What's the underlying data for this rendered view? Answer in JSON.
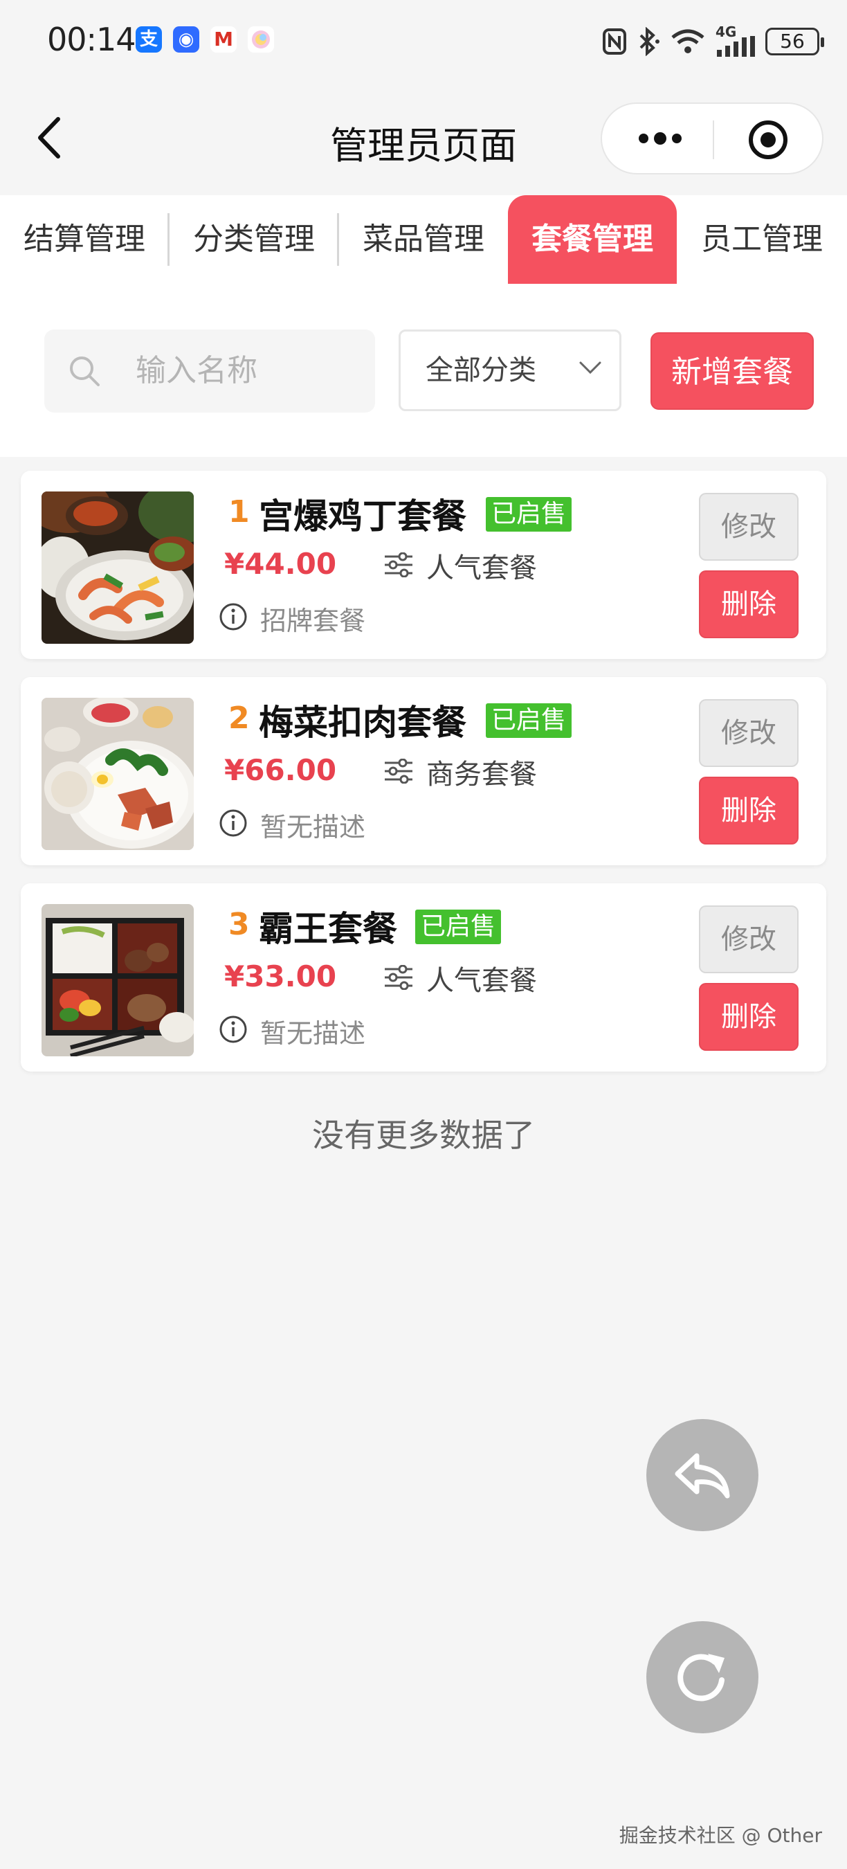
{
  "status_bar": {
    "time": "00:14",
    "network": "4G",
    "battery": "56",
    "app_icons": [
      {
        "name": "alipay-icon",
        "glyph": "支",
        "color": "#1677ff"
      },
      {
        "name": "app-shield-icon",
        "glyph": "◉",
        "color": "#2f6bff"
      },
      {
        "name": "gmail-icon",
        "glyph": "M",
        "color": "#ffffff"
      },
      {
        "name": "photos-icon",
        "glyph": "✿",
        "color": "#ffffff"
      }
    ]
  },
  "nav": {
    "title": "管理员页面"
  },
  "tabs": [
    {
      "label": "结算管理",
      "active": false
    },
    {
      "label": "分类管理",
      "active": false
    },
    {
      "label": "菜品管理",
      "active": false
    },
    {
      "label": "套餐管理",
      "active": true
    },
    {
      "label": "员工管理",
      "active": false
    }
  ],
  "filter": {
    "search_placeholder": "输入名称",
    "category_value": "全部分类",
    "add_button": "新增套餐"
  },
  "combos": [
    {
      "index": "1",
      "name": "宫爆鸡丁套餐",
      "status": "已启售",
      "price": "¥44.00",
      "category": "人气套餐",
      "description": "招牌套餐",
      "edit_label": "修改",
      "delete_label": "删除"
    },
    {
      "index": "2",
      "name": "梅菜扣肉套餐",
      "status": "已启售",
      "price": "¥66.00",
      "category": "商务套餐",
      "description": "暂无描述",
      "edit_label": "修改",
      "delete_label": "删除"
    },
    {
      "index": "3",
      "name": "霸王套餐",
      "status": "已启售",
      "price": "¥33.00",
      "category": "人气套餐",
      "description": "暂无描述",
      "edit_label": "修改",
      "delete_label": "删除"
    }
  ],
  "list_footer": "没有更多数据了",
  "watermark": "掘金技术社区 @ Other",
  "colors": {
    "accent": "#f5515f",
    "status_green": "#44c02e",
    "price_red": "#e8424f",
    "index_orange": "#f08a24"
  }
}
